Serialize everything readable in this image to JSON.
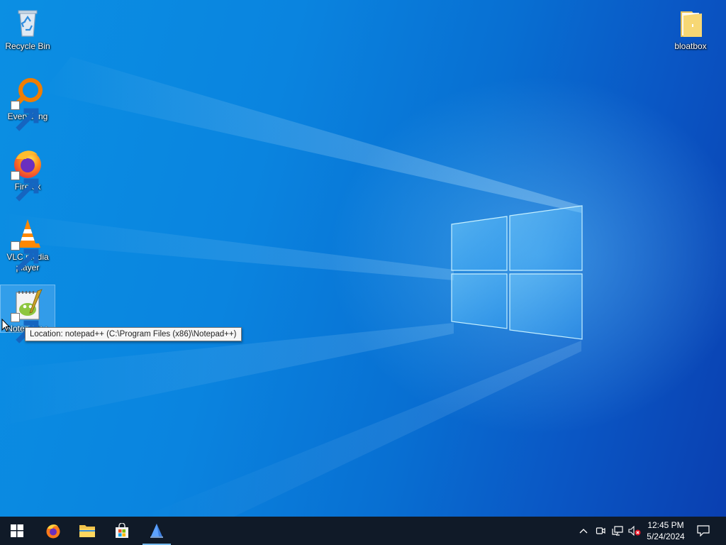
{
  "desktop": {
    "icons": [
      {
        "label": "Recycle Bin"
      },
      {
        "label": "Everything"
      },
      {
        "label": "Firefox"
      },
      {
        "label": "VLC media player"
      },
      {
        "label": "Notepad++"
      },
      {
        "label": "bloatbox"
      }
    ],
    "tooltip": "Location: notepad++ (C:\\Program Files (x86)\\Notepad++)"
  },
  "taskbar": {
    "pinned": [
      {
        "icon": "windows-start-icon"
      },
      {
        "icon": "firefox-icon"
      },
      {
        "icon": "file-explorer-icon"
      },
      {
        "icon": "microsoft-store-icon"
      },
      {
        "icon": "app-icon",
        "active": true
      }
    ],
    "tray": {
      "icons": [
        "chevron-up-icon",
        "meet-now-icon",
        "network-icon",
        "volume-muted-icon",
        "notification-icon"
      ],
      "time": "12:45 PM",
      "date": "5/24/2024"
    }
  },
  "colors": {
    "taskbar": "#101a28",
    "desktop_blue": "#0a84df",
    "accent": "#76b9ed"
  }
}
